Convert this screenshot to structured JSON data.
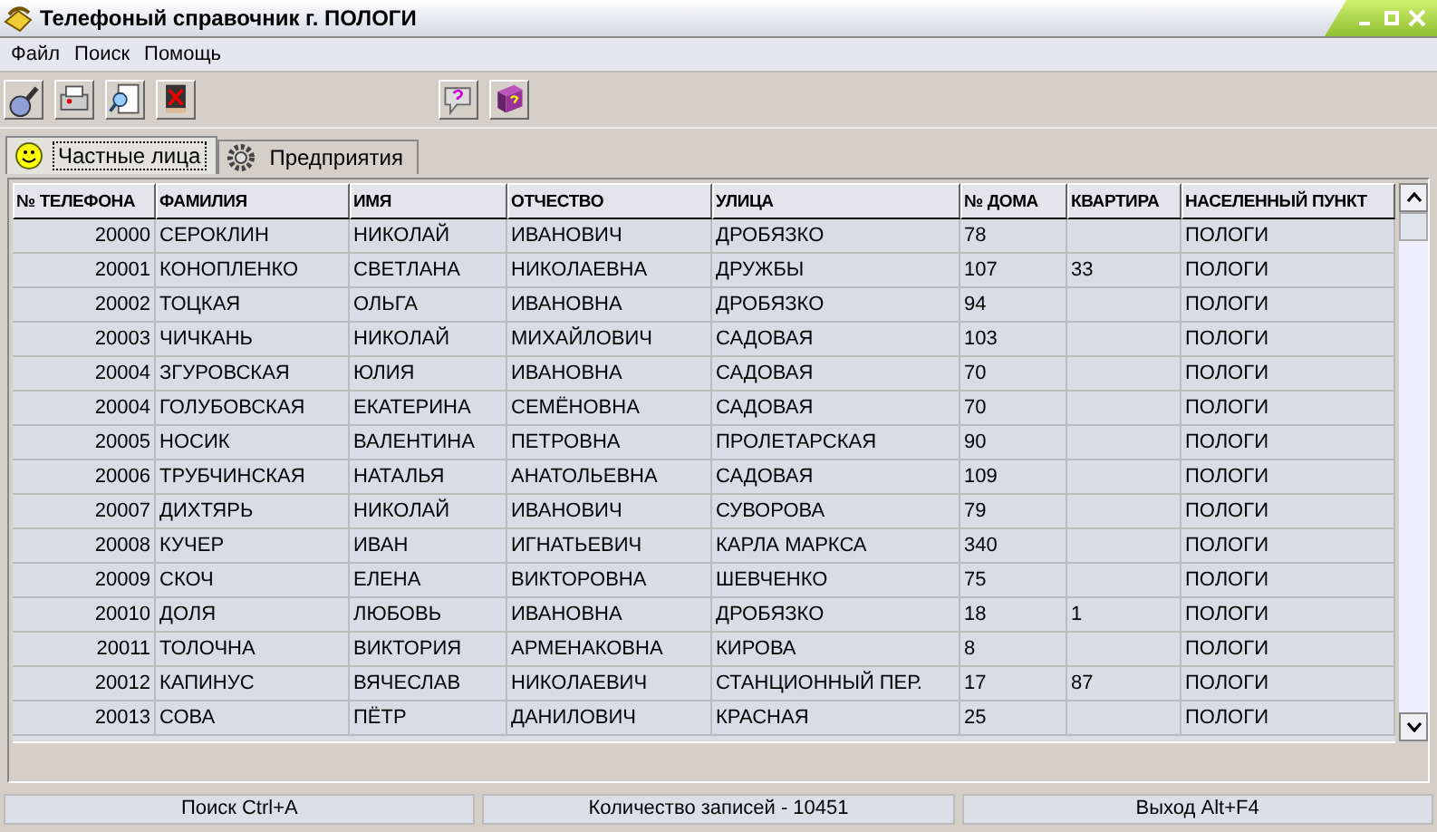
{
  "window": {
    "title": "Телефоный справочник г. ПОЛОГИ"
  },
  "menu": [
    "Файл",
    "Поиск",
    "Помощь"
  ],
  "tabs": [
    {
      "label": "Частные лица",
      "selected": true
    },
    {
      "label": "Предприятия",
      "selected": false
    }
  ],
  "table": {
    "columns": [
      "№ ТЕЛЕФОНА",
      "ФАМИЛИЯ",
      "ИМЯ",
      "ОТЧЕСТВО",
      "УЛИЦА",
      "№ ДОМА",
      "КВАРТИРА",
      "НАСЕЛЕННЫЙ ПУНКТ"
    ],
    "rows": [
      [
        "20000",
        "СЕРОКЛИН",
        "НИКОЛАЙ",
        "ИВАНОВИЧ",
        "ДРОБЯЗКО",
        "78",
        "",
        "ПОЛОГИ"
      ],
      [
        "20001",
        "КОНОПЛЕНКО",
        "СВЕТЛАНА",
        "НИКОЛАЕВНА",
        "ДРУЖБЫ",
        "107",
        "33",
        "ПОЛОГИ"
      ],
      [
        "20002",
        "ТОЦКАЯ",
        "ОЛЬГА",
        "ИВАНОВНА",
        "ДРОБЯЗКО",
        "94",
        "",
        "ПОЛОГИ"
      ],
      [
        "20003",
        "ЧИЧКАНЬ",
        "НИКОЛАЙ",
        "МИХАЙЛОВИЧ",
        "САДОВАЯ",
        "103",
        "",
        "ПОЛОГИ"
      ],
      [
        "20004",
        "ЗГУРОВСКАЯ",
        "ЮЛИЯ",
        "ИВАНОВНА",
        "САДОВАЯ",
        "70",
        "",
        "ПОЛОГИ"
      ],
      [
        "20004",
        "ГОЛУБОВСКАЯ",
        "ЕКАТЕРИНА",
        "СЕМЁНОВНА",
        "САДОВАЯ",
        "70",
        "",
        "ПОЛОГИ"
      ],
      [
        "20005",
        "НОСИК",
        "ВАЛЕНТИНА",
        "ПЕТРОВНА",
        "ПРОЛЕТАРСКАЯ",
        "90",
        "",
        "ПОЛОГИ"
      ],
      [
        "20006",
        "ТРУБЧИНСКАЯ",
        "НАТАЛЬЯ",
        "АНАТОЛЬЕВНА",
        "САДОВАЯ",
        "109",
        "",
        "ПОЛОГИ"
      ],
      [
        "20007",
        "ДИХТЯРЬ",
        "НИКОЛАЙ",
        "ИВАНОВИЧ",
        "СУВОРОВА",
        "79",
        "",
        "ПОЛОГИ"
      ],
      [
        "20008",
        "КУЧЕР",
        "ИВАН",
        "ИГНАТЬЕВИЧ",
        "КАРЛА МАРКСА",
        "340",
        "",
        "ПОЛОГИ"
      ],
      [
        "20009",
        "СКОЧ",
        "ЕЛЕНА",
        "ВИКТОРОВНА",
        "ШЕВЧЕНКО",
        "75",
        "",
        "ПОЛОГИ"
      ],
      [
        "20010",
        "ДОЛЯ",
        "ЛЮБОВЬ",
        "ИВАНОВНА",
        "ДРОБЯЗКО",
        "18",
        "1",
        "ПОЛОГИ"
      ],
      [
        "20011",
        "ТОЛОЧНА",
        "ВИКТОРИЯ",
        "АРМЕНАКОВНА",
        "КИРОВА",
        "8",
        "",
        "ПОЛОГИ"
      ],
      [
        "20012",
        "КАПИНУС",
        "ВЯЧЕСЛАВ",
        "НИКОЛАЕВИЧ",
        "СТАНЦИОННЫЙ ПЕР.",
        "17",
        "87",
        "ПОЛОГИ"
      ],
      [
        "20013",
        "СОВА",
        "ПЁТР",
        "ДАНИЛОВИЧ",
        "КРАСНАЯ",
        "25",
        "",
        "ПОЛОГИ"
      ]
    ]
  },
  "status_bar": [
    "Поиск Ctrl+A",
    "Количество записей - 10451",
    "Выход Alt+F4"
  ]
}
